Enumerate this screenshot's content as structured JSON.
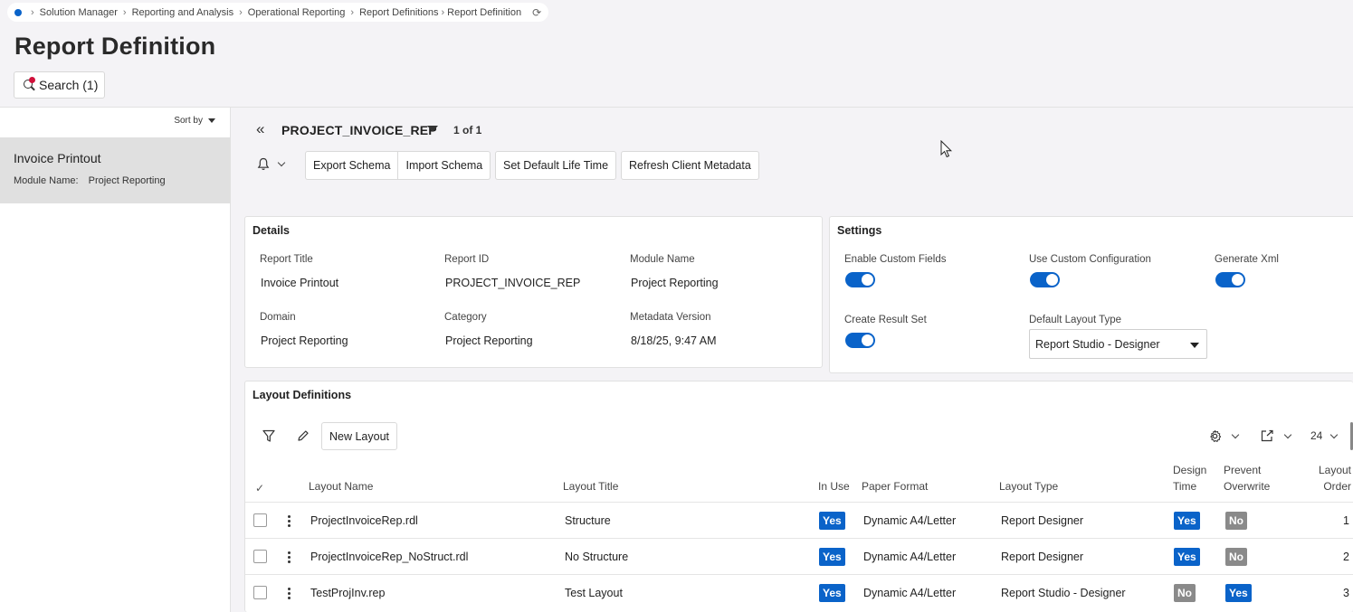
{
  "breadcrumb": {
    "items": [
      "Solution Manager",
      "Reporting and Analysis",
      "Operational Reporting",
      "Report Definitions",
      "Report Definition"
    ]
  },
  "page": {
    "title": "Report Definition",
    "search_label": "Search (1)"
  },
  "left_panel": {
    "sort_label": "Sort by",
    "record": {
      "title": "Invoice Printout",
      "module_label": "Module Name:",
      "module_value": "Project Reporting"
    }
  },
  "header": {
    "record_name": "PROJECT_INVOICE_REP",
    "pager": "1 of 1",
    "buttons": {
      "export_schema": "Export Schema",
      "import_schema": "Import Schema",
      "set_default_life_time": "Set Default Life Time",
      "refresh_client_metadata": "Refresh Client Metadata"
    }
  },
  "details": {
    "title": "Details",
    "fields": {
      "report_title": {
        "label": "Report Title",
        "value": "Invoice Printout"
      },
      "report_id": {
        "label": "Report ID",
        "value": "PROJECT_INVOICE_REP"
      },
      "module_name": {
        "label": "Module Name",
        "value": "Project Reporting"
      },
      "domain": {
        "label": "Domain",
        "value": "Project Reporting"
      },
      "category": {
        "label": "Category",
        "value": "Project Reporting"
      },
      "metadata_version": {
        "label": "Metadata Version",
        "value": "8/18/25, 9:47 AM"
      }
    }
  },
  "settings": {
    "title": "Settings",
    "enable_custom_fields": {
      "label": "Enable Custom Fields",
      "on": true
    },
    "use_custom_configuration": {
      "label": "Use Custom Configuration",
      "on": true
    },
    "generate_xml": {
      "label": "Generate Xml",
      "on": true
    },
    "create_result_set": {
      "label": "Create Result Set",
      "on": true
    },
    "default_layout_type": {
      "label": "Default Layout Type",
      "value": "Report Studio - Designer"
    }
  },
  "layouts": {
    "title": "Layout Definitions",
    "new_layout_label": "New Layout",
    "page_size": "24",
    "columns": {
      "layout_name": "Layout Name",
      "layout_title": "Layout Title",
      "in_use": "In Use",
      "paper_format": "Paper Format",
      "layout_type": "Layout Type",
      "design_time_1": "Design",
      "design_time_2": "Time",
      "prevent_overwrite_1": "Prevent",
      "prevent_overwrite_2": "Overwrite",
      "layout_order_1": "Layout",
      "layout_order_2": "Order"
    },
    "rows": [
      {
        "name": "ProjectInvoiceRep.rdl",
        "title": "Structure",
        "in_use": "Yes",
        "paper_format": "Dynamic A4/Letter",
        "layout_type": "Report Designer",
        "design_time": "Yes",
        "prevent_overwrite": "No",
        "order": "1"
      },
      {
        "name": "ProjectInvoiceRep_NoStruct.rdl",
        "title": "No Structure",
        "in_use": "Yes",
        "paper_format": "Dynamic A4/Letter",
        "layout_type": "Report Designer",
        "design_time": "Yes",
        "prevent_overwrite": "No",
        "order": "2"
      },
      {
        "name": "TestProjInv.rep",
        "title": "Test Layout",
        "in_use": "Yes",
        "paper_format": "Dynamic A4/Letter",
        "layout_type": "Report Studio - Designer",
        "design_time": "No",
        "prevent_overwrite": "Yes",
        "order": "3"
      }
    ]
  },
  "colors": {
    "accent": "#0a63c9",
    "badge_no": "#8a8a8a",
    "background": "#f4f3f6"
  }
}
